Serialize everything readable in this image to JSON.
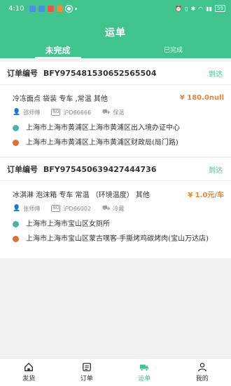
{
  "status_bar": {
    "time": "4:10",
    "battery": "59"
  },
  "header": {
    "title": "运单"
  },
  "tabs": [
    {
      "label": "未完成",
      "active": true
    },
    {
      "label": "已完成",
      "active": false
    }
  ],
  "orders": [
    {
      "order_label": "订单编号",
      "order_no": "BFY975481530652565504",
      "status": "到达",
      "cargo": "冷冻面点 袋装 专车 ,常温 其他",
      "price": "¥ 180.0null",
      "driver": "邵师傅",
      "plate": "沪D66666",
      "temp": "保温",
      "from": "上海市上海市黄浦区上海市黄浦区出入境办证中心",
      "to": "上海市上海市黄浦区上海市黄浦区财政局(局门路)"
    },
    {
      "order_label": "订单编号",
      "order_no": "BFY975450639427444736",
      "status": "到达",
      "cargo": "冰淇淋 泡沫箱 专车 常温 （环境温度） 其他",
      "price": "¥ 1.0元/车",
      "driver": "张师傅",
      "plate": "沪D66002",
      "temp": "冷藏",
      "from": "上海市上海市宝山区女厕所",
      "to": "上海市上海市宝山区蒙古嘿客·手撕烤鸡碳烤肉(宝山万达店)"
    }
  ],
  "bottom_nav": [
    {
      "label": "发货",
      "icon": "home-icon",
      "active": false
    },
    {
      "label": "订单",
      "icon": "list-icon",
      "active": false
    },
    {
      "label": "运单",
      "icon": "truck-icon",
      "active": true
    },
    {
      "label": "我的",
      "icon": "person-icon",
      "active": false
    }
  ],
  "colors": {
    "brand": "#41c38e",
    "price": "#e4843a",
    "start_dot": "#4bb2a6",
    "end_dot": "#d9713a"
  }
}
